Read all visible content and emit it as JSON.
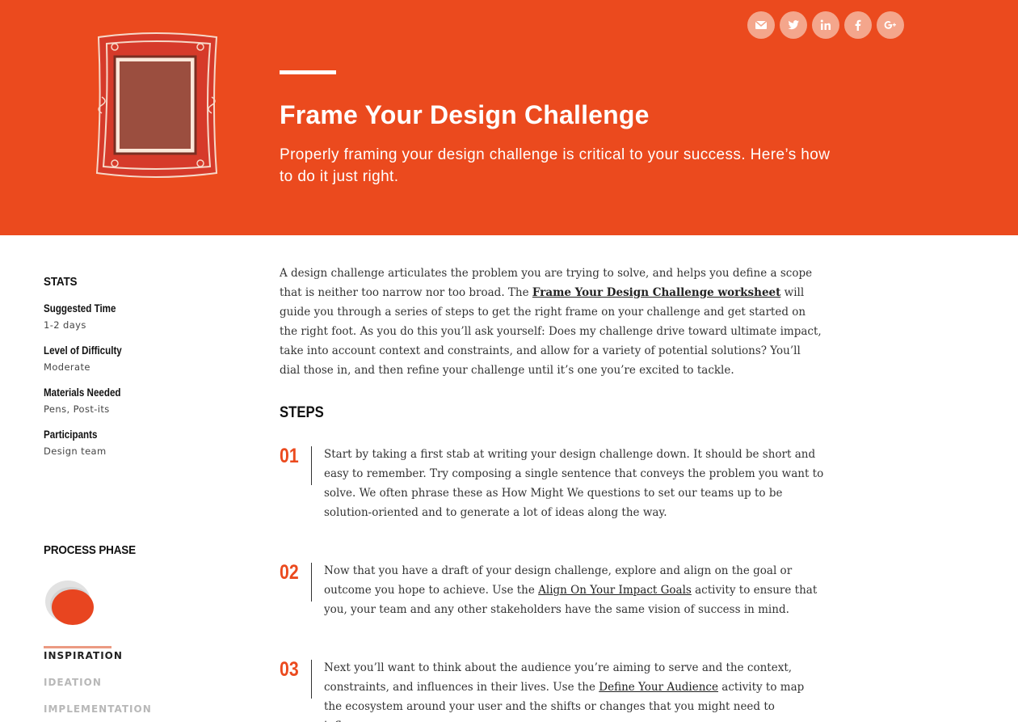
{
  "hero": {
    "title": "Frame Your Design Challenge",
    "subtitle": "Properly framing your design challenge is critical to your success. Here’s how to do it just right.",
    "background": "#eb4a1e"
  },
  "social": [
    {
      "icon": "email-icon"
    },
    {
      "icon": "twitter-icon"
    },
    {
      "icon": "linkedin-icon"
    },
    {
      "icon": "facebook-icon"
    },
    {
      "icon": "google-plus-icon"
    }
  ],
  "sidebar": {
    "stats_heading": "STATS",
    "stats": [
      {
        "label": "Suggested Time",
        "value": "1-2 days"
      },
      {
        "label": "Level of Difficulty",
        "value": "Moderate"
      },
      {
        "label": "Materials Needed",
        "value": "Pens, Post-its"
      },
      {
        "label": "Participants",
        "value": "Design team"
      }
    ],
    "phase_heading": "PROCESS PHASE",
    "phases": [
      "INSPIRATION",
      "IDEATION",
      "IMPLEMENTATION"
    ]
  },
  "main": {
    "intro": {
      "part1": "A design challenge articulates the problem you are trying to solve, and helps you define a scope that is neither too narrow nor too broad. The ",
      "link": "Frame Your Design Challenge worksheet",
      "part2": " will guide you through a series of steps to get the right frame on your challenge and get started on the right foot. As you do this you’ll ask yourself: Does my challenge drive toward ultimate impact, take into account context and constraints, and allow for a variety of potential solutions? You’ll dial those in, and then refine your challenge until it’s one you’re excited to tackle."
    },
    "steps_heading": "STEPS",
    "steps": [
      {
        "number": "01",
        "before": "Start by taking a first stab at writing your design challenge down. It should be short and easy to remember. Try composing a single sentence that conveys the problem you want to solve. We often phrase these as How Might We questions to set our teams up to be solution-oriented and to generate a lot of ideas along the way.",
        "link": "",
        "after": ""
      },
      {
        "number": "02",
        "before": "Now that you have a draft of your design challenge, explore and align on the goal or outcome you hope to achieve. Use the ",
        "link": "Align On Your Impact Goals",
        "after": " activity to ensure that you, your team and any other stakeholders have the same vision of success in mind."
      },
      {
        "number": "03",
        "before": "Next you’ll want to think about the audience you’re aiming to serve and the context, constraints, and influences in their lives. Use the ",
        "link": "Define Your Audience",
        "after": " activity to map the ecosystem around your user and the shifts or changes that you might need to influence"
      }
    ]
  }
}
